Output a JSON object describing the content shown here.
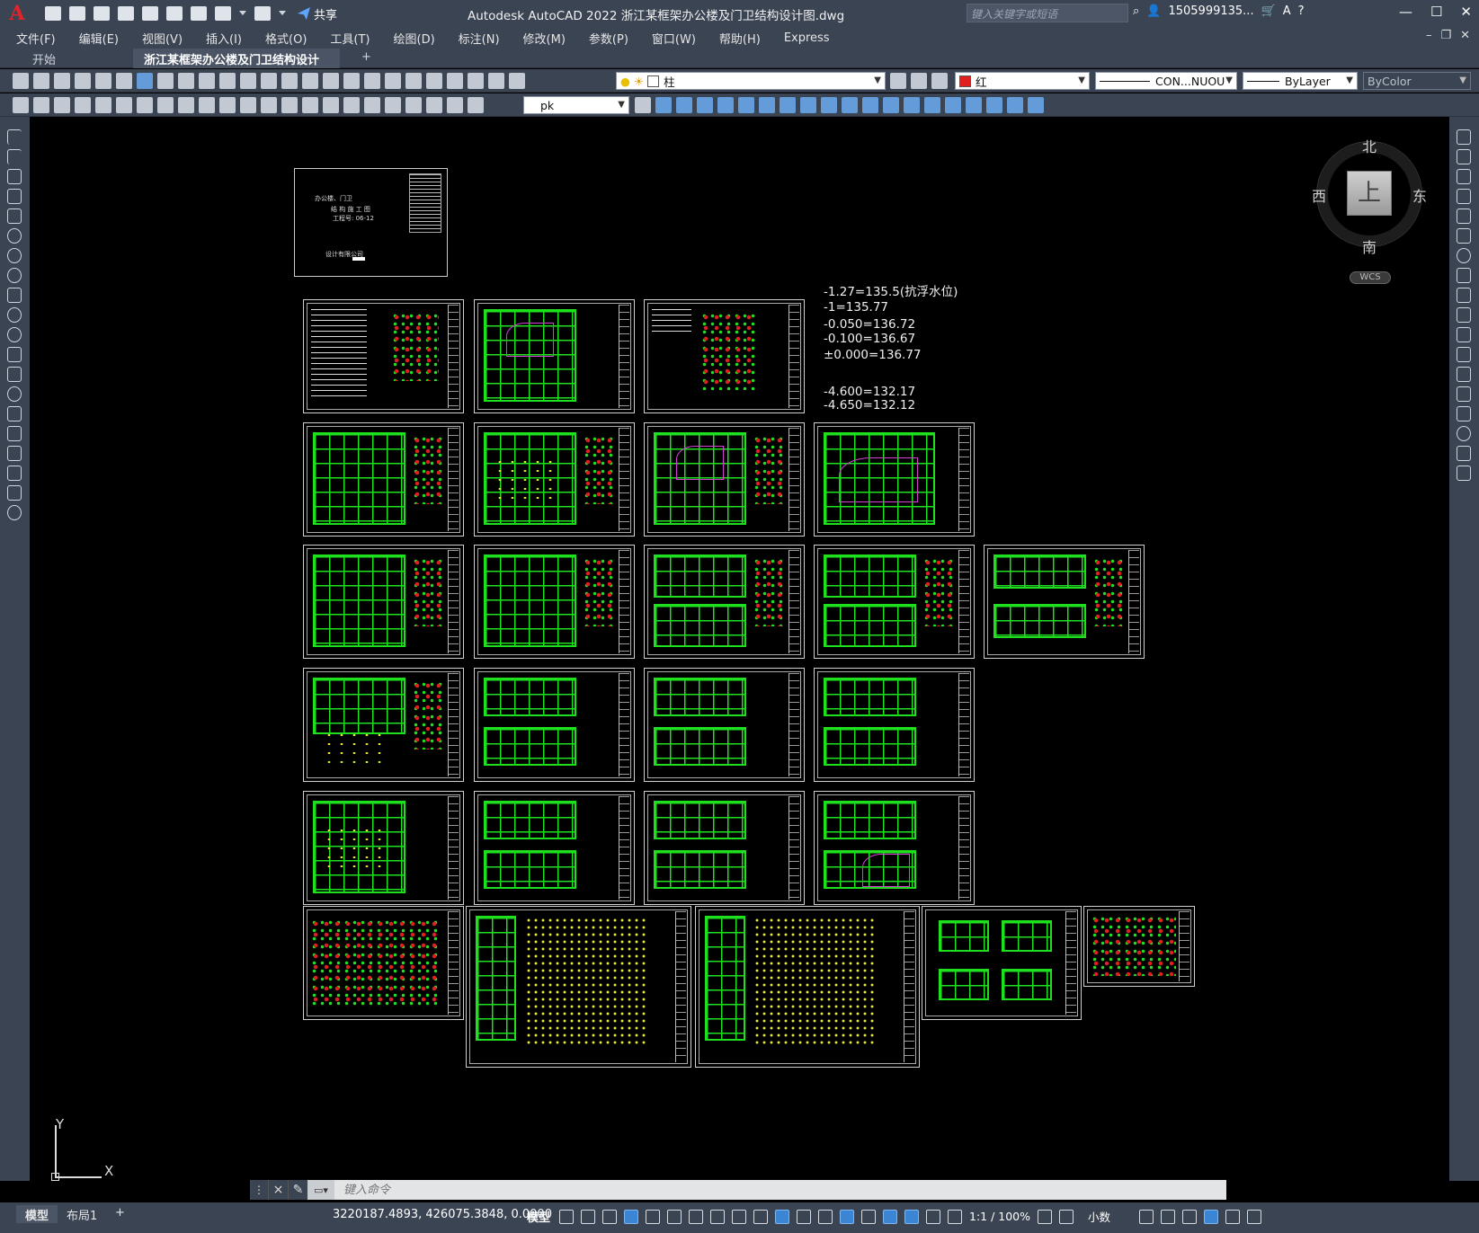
{
  "app": {
    "logo": "A",
    "title": "Autodesk AutoCAD 2022    浙江某框架办公楼及门卫结构设计图.dwg",
    "search_placeholder": "键入关键字或短语",
    "user": "1505999135...",
    "share_label": "共享"
  },
  "menu": [
    "文件(F)",
    "编辑(E)",
    "视图(V)",
    "插入(I)",
    "格式(O)",
    "工具(T)",
    "绘图(D)",
    "标注(N)",
    "修改(M)",
    "参数(P)",
    "窗口(W)",
    "帮助(H)",
    "Express"
  ],
  "file_tabs": {
    "start": "开始",
    "active": "浙江某框架办公楼及门卫结构设计图*",
    "close": "×",
    "add": "+"
  },
  "toolbar": {
    "layer_value": "柱",
    "color_value": "红",
    "linetype_value": "CON...NUOU",
    "lineweight_value": "ByLayer",
    "plotstyle_value": "ByColor",
    "textstyle_value": "pk"
  },
  "drawing": {
    "cover_lines": [
      "办公楼、门卫",
      "结 构 施 工 图",
      "工程号: 06-12",
      "设计有限公司"
    ],
    "elevations": [
      "-1.27=135.5(抗浮水位)",
      "-1=135.77",
      "-0.050=136.72",
      "-0.100=136.67",
      "±0.000=136.77",
      "-4.600=132.17",
      "-4.650=132.12"
    ]
  },
  "viewcube": {
    "north": "北",
    "south": "南",
    "east": "东",
    "west": "西",
    "face": "上",
    "wcs": "WCS"
  },
  "ucs": {
    "x": "X",
    "y": "Y"
  },
  "command": {
    "placeholder": "键入命令",
    "close": "×"
  },
  "status": {
    "tabs": [
      "模型",
      "布局1"
    ],
    "add": "+",
    "coords": "3220187.4893, 426075.3848, 0.0000",
    "space": "模型",
    "scale": "1:1 / 100%",
    "units": "小数"
  },
  "colors": {
    "accent_green": "#1fe01f",
    "accent_red": "#e02020",
    "chrome": "#3b4453"
  }
}
